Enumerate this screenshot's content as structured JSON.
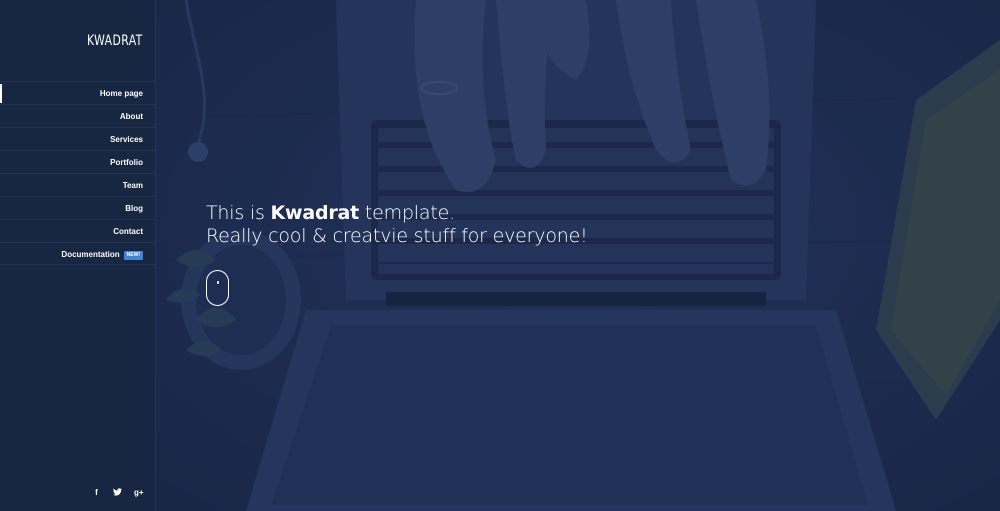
{
  "brand": {
    "name": "KWADRAT"
  },
  "nav": {
    "items": [
      {
        "label": "Home page",
        "active": true
      },
      {
        "label": "About"
      },
      {
        "label": "Services"
      },
      {
        "label": "Portfolio"
      },
      {
        "label": "Team"
      },
      {
        "label": "Blog"
      },
      {
        "label": "Contact"
      },
      {
        "label": "Documentation",
        "badge": "NEW!"
      }
    ]
  },
  "social": [
    {
      "icon": "facebook-icon",
      "glyph": "f"
    },
    {
      "icon": "twitter-icon",
      "glyph": "🐦"
    },
    {
      "icon": "google-plus-icon",
      "glyph": "g+"
    }
  ],
  "hero": {
    "line1_prefix": "This is ",
    "line1_brand": "Kwadrat",
    "line1_suffix": " template.",
    "line2": "Really cool & creatvie stuff for everyone!"
  },
  "colors": {
    "sidebar_bg": "#172641",
    "overlay": "#1c2d52",
    "badge": "#3f86d6",
    "text": "#ffffff"
  }
}
